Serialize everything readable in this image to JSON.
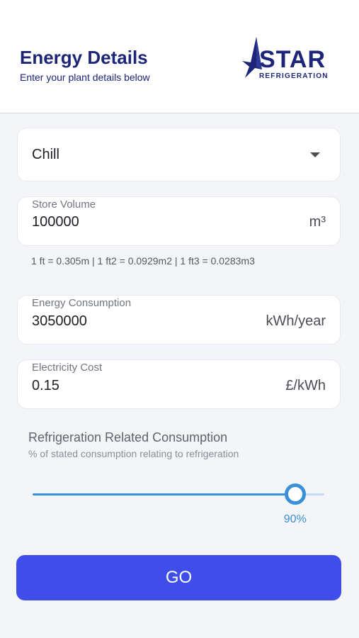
{
  "header": {
    "title": "Energy Details",
    "subtitle": "Enter your plant details below",
    "logo": {
      "word": "STAR",
      "tagline": "REFRIGERATION",
      "brand_color": "#1c2577",
      "icon": "star-logo-icon"
    }
  },
  "form": {
    "storage_type": {
      "value": "Chill",
      "icon": "caret-down-icon"
    },
    "store_volume": {
      "label": "Store Volume",
      "value": "100000",
      "unit": "m³"
    },
    "conversion_note": "1 ft = 0.305m  |  1 ft2 = 0.0929m2  |  1 ft3 = 0.0283m3",
    "energy_consumption": {
      "label": "Energy Consumption",
      "value": "3050000",
      "unit": "kWh/year"
    },
    "electricity_cost": {
      "label": "Electricity Cost",
      "value": "0.15",
      "unit": "£/kWh"
    },
    "refrigeration": {
      "title": "Refrigeration Related Consumption",
      "subtitle": "% of stated consumption relating to refrigeration",
      "percent": 90,
      "value_label": "90%"
    }
  },
  "actions": {
    "go_label": "GO"
  },
  "colors": {
    "accent": "#3a8fd9",
    "button": "#3f4ee8",
    "heading": "#1c2577"
  }
}
